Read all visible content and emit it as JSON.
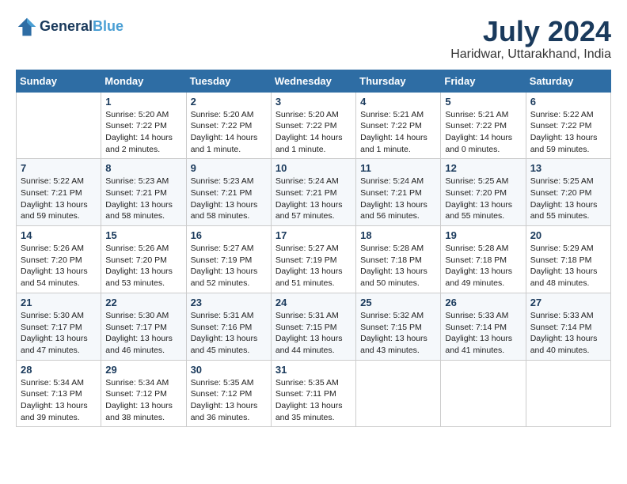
{
  "header": {
    "logo_line1": "General",
    "logo_line2": "Blue",
    "month_year": "July 2024",
    "location": "Haridwar, Uttarakhand, India"
  },
  "columns": [
    "Sunday",
    "Monday",
    "Tuesday",
    "Wednesday",
    "Thursday",
    "Friday",
    "Saturday"
  ],
  "weeks": [
    [
      {
        "num": "",
        "info": ""
      },
      {
        "num": "1",
        "info": "Sunrise: 5:20 AM\nSunset: 7:22 PM\nDaylight: 14 hours\nand 2 minutes."
      },
      {
        "num": "2",
        "info": "Sunrise: 5:20 AM\nSunset: 7:22 PM\nDaylight: 14 hours\nand 1 minute."
      },
      {
        "num": "3",
        "info": "Sunrise: 5:20 AM\nSunset: 7:22 PM\nDaylight: 14 hours\nand 1 minute."
      },
      {
        "num": "4",
        "info": "Sunrise: 5:21 AM\nSunset: 7:22 PM\nDaylight: 14 hours\nand 1 minute."
      },
      {
        "num": "5",
        "info": "Sunrise: 5:21 AM\nSunset: 7:22 PM\nDaylight: 14 hours\nand 0 minutes."
      },
      {
        "num": "6",
        "info": "Sunrise: 5:22 AM\nSunset: 7:22 PM\nDaylight: 13 hours\nand 59 minutes."
      }
    ],
    [
      {
        "num": "7",
        "info": "Sunrise: 5:22 AM\nSunset: 7:21 PM\nDaylight: 13 hours\nand 59 minutes."
      },
      {
        "num": "8",
        "info": "Sunrise: 5:23 AM\nSunset: 7:21 PM\nDaylight: 13 hours\nand 58 minutes."
      },
      {
        "num": "9",
        "info": "Sunrise: 5:23 AM\nSunset: 7:21 PM\nDaylight: 13 hours\nand 58 minutes."
      },
      {
        "num": "10",
        "info": "Sunrise: 5:24 AM\nSunset: 7:21 PM\nDaylight: 13 hours\nand 57 minutes."
      },
      {
        "num": "11",
        "info": "Sunrise: 5:24 AM\nSunset: 7:21 PM\nDaylight: 13 hours\nand 56 minutes."
      },
      {
        "num": "12",
        "info": "Sunrise: 5:25 AM\nSunset: 7:20 PM\nDaylight: 13 hours\nand 55 minutes."
      },
      {
        "num": "13",
        "info": "Sunrise: 5:25 AM\nSunset: 7:20 PM\nDaylight: 13 hours\nand 55 minutes."
      }
    ],
    [
      {
        "num": "14",
        "info": "Sunrise: 5:26 AM\nSunset: 7:20 PM\nDaylight: 13 hours\nand 54 minutes."
      },
      {
        "num": "15",
        "info": "Sunrise: 5:26 AM\nSunset: 7:20 PM\nDaylight: 13 hours\nand 53 minutes."
      },
      {
        "num": "16",
        "info": "Sunrise: 5:27 AM\nSunset: 7:19 PM\nDaylight: 13 hours\nand 52 minutes."
      },
      {
        "num": "17",
        "info": "Sunrise: 5:27 AM\nSunset: 7:19 PM\nDaylight: 13 hours\nand 51 minutes."
      },
      {
        "num": "18",
        "info": "Sunrise: 5:28 AM\nSunset: 7:18 PM\nDaylight: 13 hours\nand 50 minutes."
      },
      {
        "num": "19",
        "info": "Sunrise: 5:28 AM\nSunset: 7:18 PM\nDaylight: 13 hours\nand 49 minutes."
      },
      {
        "num": "20",
        "info": "Sunrise: 5:29 AM\nSunset: 7:18 PM\nDaylight: 13 hours\nand 48 minutes."
      }
    ],
    [
      {
        "num": "21",
        "info": "Sunrise: 5:30 AM\nSunset: 7:17 PM\nDaylight: 13 hours\nand 47 minutes."
      },
      {
        "num": "22",
        "info": "Sunrise: 5:30 AM\nSunset: 7:17 PM\nDaylight: 13 hours\nand 46 minutes."
      },
      {
        "num": "23",
        "info": "Sunrise: 5:31 AM\nSunset: 7:16 PM\nDaylight: 13 hours\nand 45 minutes."
      },
      {
        "num": "24",
        "info": "Sunrise: 5:31 AM\nSunset: 7:15 PM\nDaylight: 13 hours\nand 44 minutes."
      },
      {
        "num": "25",
        "info": "Sunrise: 5:32 AM\nSunset: 7:15 PM\nDaylight: 13 hours\nand 43 minutes."
      },
      {
        "num": "26",
        "info": "Sunrise: 5:33 AM\nSunset: 7:14 PM\nDaylight: 13 hours\nand 41 minutes."
      },
      {
        "num": "27",
        "info": "Sunrise: 5:33 AM\nSunset: 7:14 PM\nDaylight: 13 hours\nand 40 minutes."
      }
    ],
    [
      {
        "num": "28",
        "info": "Sunrise: 5:34 AM\nSunset: 7:13 PM\nDaylight: 13 hours\nand 39 minutes."
      },
      {
        "num": "29",
        "info": "Sunrise: 5:34 AM\nSunset: 7:12 PM\nDaylight: 13 hours\nand 38 minutes."
      },
      {
        "num": "30",
        "info": "Sunrise: 5:35 AM\nSunset: 7:12 PM\nDaylight: 13 hours\nand 36 minutes."
      },
      {
        "num": "31",
        "info": "Sunrise: 5:35 AM\nSunset: 7:11 PM\nDaylight: 13 hours\nand 35 minutes."
      },
      {
        "num": "",
        "info": ""
      },
      {
        "num": "",
        "info": ""
      },
      {
        "num": "",
        "info": ""
      }
    ]
  ]
}
